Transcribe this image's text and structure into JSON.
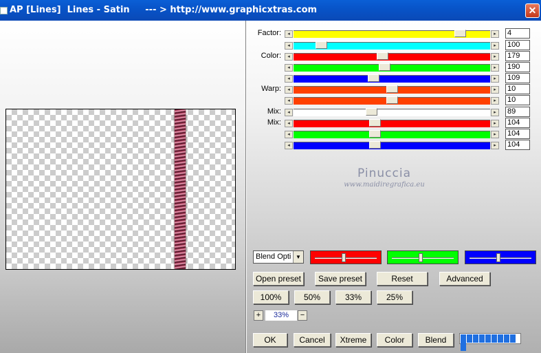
{
  "window": {
    "title": "AP [Lines]  Lines - Satin     --- > http://www.graphicxtras.com",
    "close_symbol": "✕"
  },
  "sliders": [
    {
      "label": "Factor:",
      "color": "#ffff00",
      "value": "4",
      "level": 0.87
    },
    {
      "label": "",
      "color": "#00ffff",
      "value": "100",
      "level": 0.12
    },
    {
      "label": "Color:",
      "color": "#ff0000",
      "value": "179",
      "level": 0.45
    },
    {
      "label": "",
      "color": "#00ff00",
      "value": "190",
      "level": 0.46
    },
    {
      "label": "",
      "color": "#0000ff",
      "value": "109",
      "level": 0.4
    },
    {
      "label": "Warp:",
      "color": "#ff4000",
      "value": "10",
      "level": 0.5
    },
    {
      "label": "",
      "color": "#ff4000",
      "value": "10",
      "level": 0.5
    },
    {
      "label": "Mix:",
      "color": "#ffffff",
      "value": "89",
      "level": 0.39
    },
    {
      "label": "Mix:",
      "color": "#ff0000",
      "value": "104",
      "level": 0.41
    },
    {
      "label": "",
      "color": "#00ff00",
      "value": "104",
      "level": 0.41
    },
    {
      "label": "",
      "color": "#0000ff",
      "value": "104",
      "level": 0.41
    }
  ],
  "arrows": {
    "left": "◂",
    "right": "▸"
  },
  "watermark": {
    "line1": "Pinuccia",
    "line2": "www.maidiregrafica.eu"
  },
  "blend_select": {
    "value": "Blend Opti",
    "arrow": "▼"
  },
  "color_blocks": [
    {
      "color": "#ff0000",
      "level": 0.46
    },
    {
      "color": "#00ff00",
      "level": 0.46
    },
    {
      "color": "#0000ff",
      "level": 0.46
    }
  ],
  "buttons": {
    "open_preset": "Open preset",
    "save_preset": "Save preset",
    "reset": "Reset",
    "advanced": "Advanced",
    "zoom100": "100%",
    "zoom50": "50%",
    "zoom33": "33%",
    "zoom25": "25%",
    "ok": "OK",
    "cancel": "Cancel",
    "xtreme": "Xtreme",
    "color": "Color",
    "blend": "Blend"
  },
  "zoom": {
    "plus": "+",
    "value": "33%",
    "minus": "−"
  },
  "progress": {
    "segments": 10,
    "filled": 10,
    "level": 1.0
  }
}
